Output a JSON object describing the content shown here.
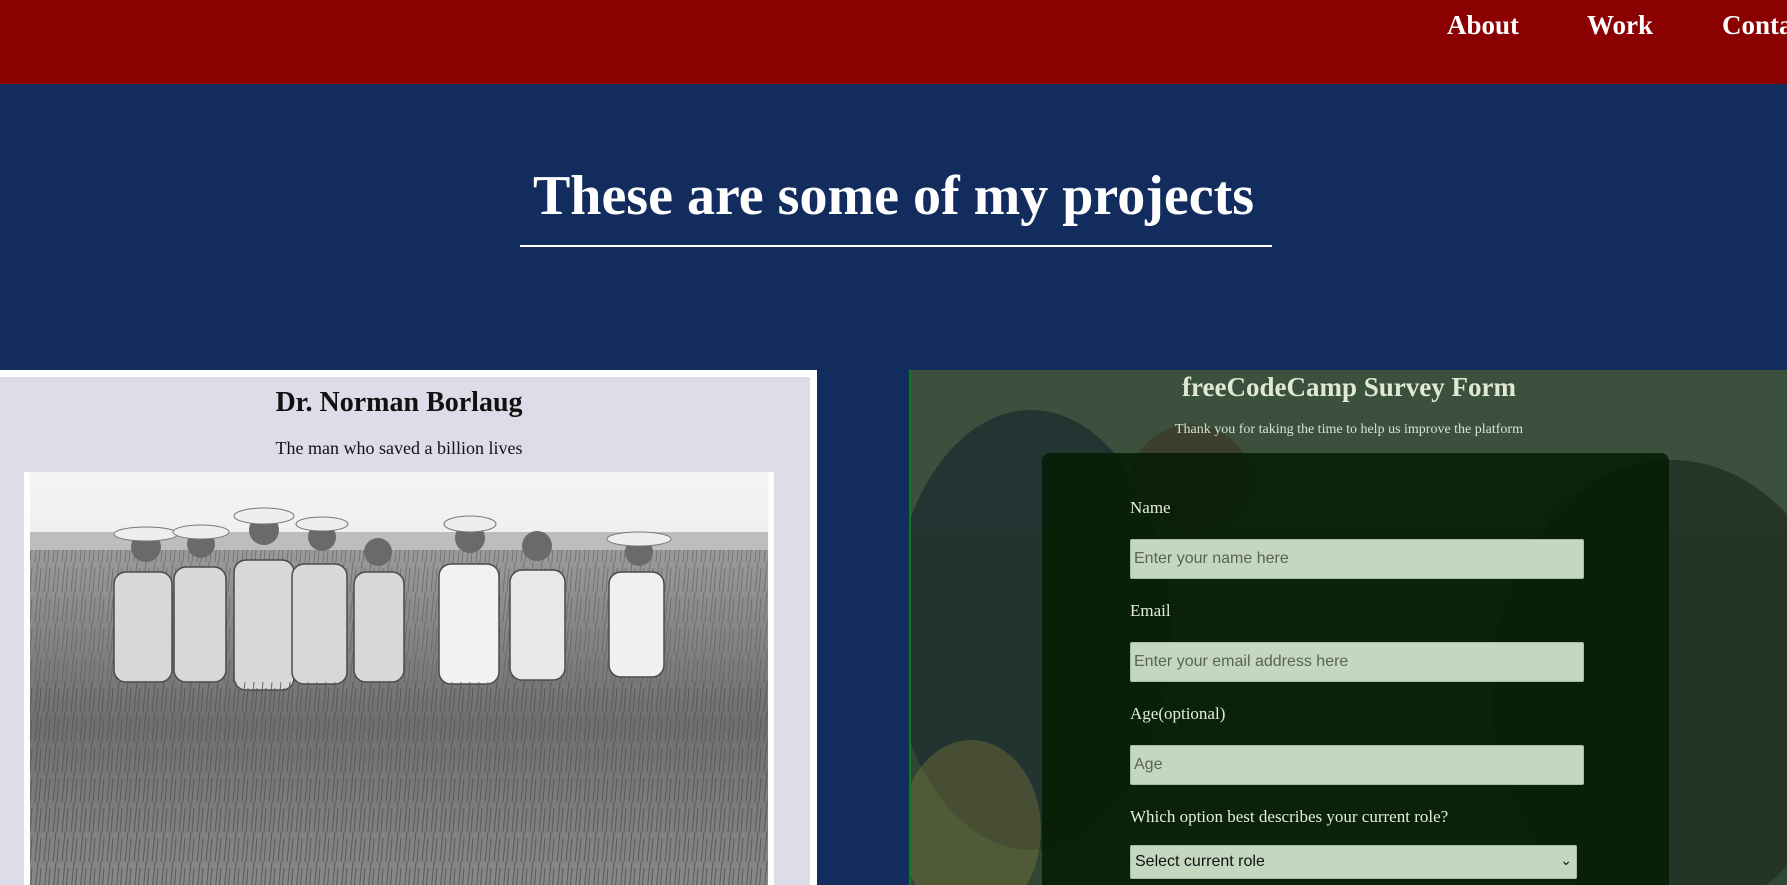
{
  "nav": {
    "links": [
      {
        "label": "About"
      },
      {
        "label": "Work"
      },
      {
        "label": "Conta"
      }
    ]
  },
  "projects": {
    "heading": "These are some of my projects",
    "tiles": [
      {
        "title": "Dr. Norman Borlaug",
        "subtitle": "The man who saved a billion lives"
      },
      {
        "title": "freeCodeCamp Survey Form",
        "subtitle": "Thank you for taking the time to help us improve the platform",
        "form": {
          "name_label": "Name",
          "name_placeholder": "Enter your name here",
          "email_label": "Email",
          "email_placeholder": "Enter your email address here",
          "age_label": "Age(optional)",
          "age_placeholder": "Age",
          "role_label": "Which option best describes your current role?",
          "role_selected": "Select current role"
        }
      }
    ]
  },
  "colors": {
    "navbar": "#8b0000",
    "section_bg": "#132c5e",
    "tile1_bg": "#dcdde8",
    "form_card": "#061e04",
    "input_bg": "#c4d8bf"
  }
}
